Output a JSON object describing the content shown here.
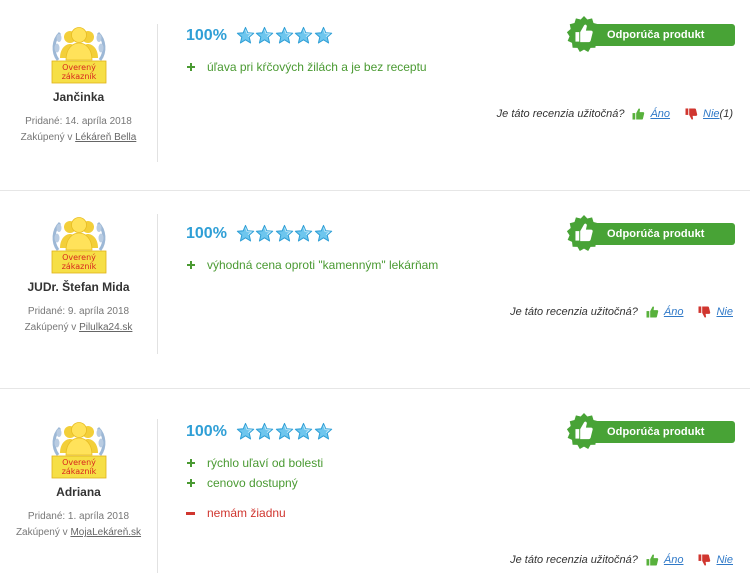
{
  "colors": {
    "accent_blue": "#2f9fd6",
    "green": "#48a336",
    "red": "#d0362f"
  },
  "common": {
    "badge_text_1": "Overený",
    "badge_text_2": "zákazník",
    "recommend_label": "Odporúča produkt",
    "helpful_question": "Je táto recenzia užitočná?",
    "yes_label": "Áno",
    "no_label": "Nie"
  },
  "reviews": [
    {
      "name": "Jančinka",
      "added": "Pridané: 14. apríla 2018",
      "bought_prefix": "Zakúpený v",
      "store": "Lékáreň Bella",
      "rating_pct": "100%",
      "stars": 5,
      "pros": [
        "úľava pri kŕčových žilách a je bez receptu"
      ],
      "cons": [],
      "no_count": "(1)"
    },
    {
      "name": "JUDr. Štefan Mida",
      "added": "Pridané: 9. apríla 2018",
      "bought_prefix": "Zakúpený v",
      "store": "Pilulka24.sk",
      "rating_pct": "100%",
      "stars": 5,
      "pros": [
        "výhodná cena oproti \"kamenným\" lekárňam"
      ],
      "cons": [],
      "no_count": ""
    },
    {
      "name": "Adriana",
      "added": "Pridané: 1. apríla 2018",
      "bought_prefix": "Zakúpený v",
      "store": "MojaLekáreň.sk",
      "rating_pct": "100%",
      "stars": 5,
      "pros": [
        "rýchlo uľaví od bolesti",
        "cenovo dostupný"
      ],
      "cons": [
        "nemám žiadnu"
      ],
      "no_count": ""
    }
  ]
}
